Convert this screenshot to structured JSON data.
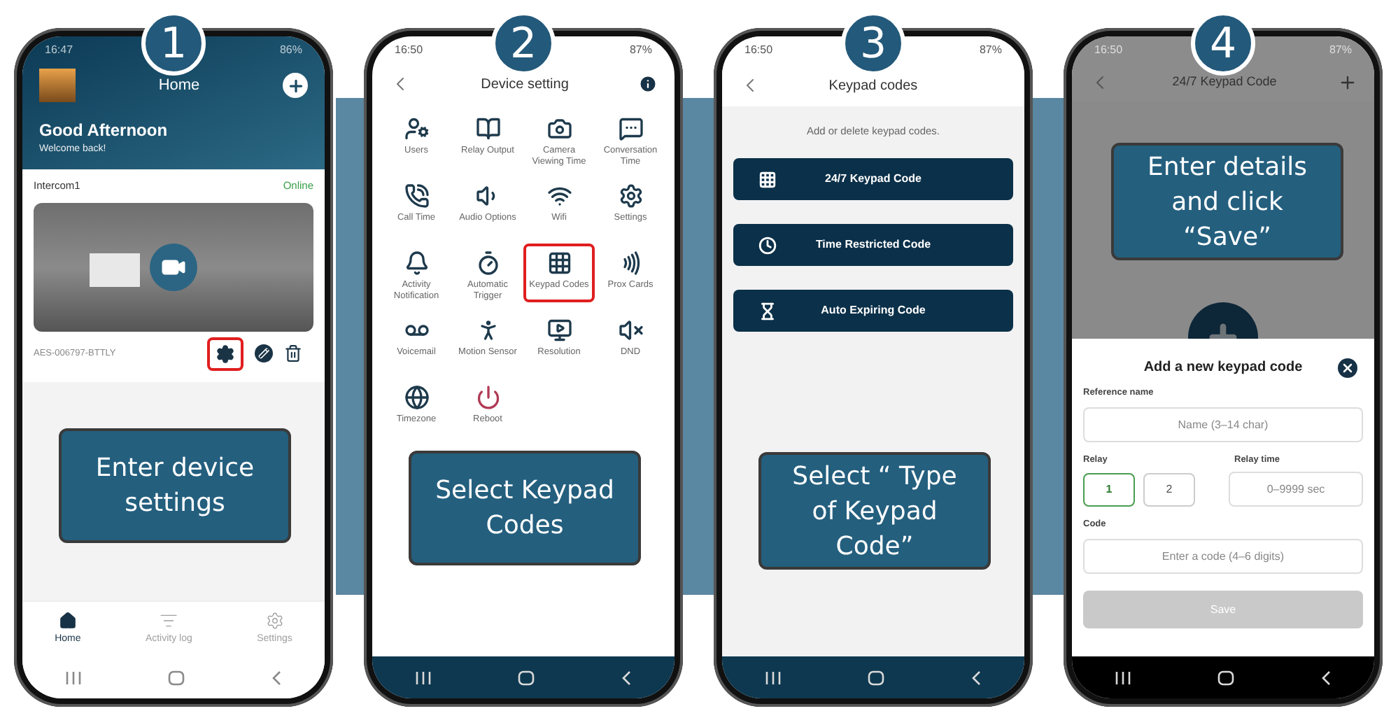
{
  "phones": [
    {
      "kind": "home",
      "step": "1",
      "instruction": "Enter device settings",
      "status": {
        "time": "16:47",
        "battery": "86%"
      },
      "title": "Home",
      "greeting": "Good Afternoon",
      "subtitle": "Welcome back!",
      "device": {
        "name": "Intercom1",
        "state": "Online",
        "id": "AES-006797-BTTLY",
        "settings_highlighted": true
      },
      "nav": [
        {
          "label": "Home",
          "selected": true
        },
        {
          "label": "Activity log",
          "selected": false
        },
        {
          "label": "Settings",
          "selected": false
        }
      ]
    },
    {
      "kind": "settings_grid",
      "step": "2",
      "instruction": "Select Keypad Codes",
      "status": {
        "time": "16:50",
        "battery": "87%"
      },
      "title": "Device setting",
      "items": [
        {
          "label": "Users",
          "highlighted": false,
          "color": "#1e3a4c"
        },
        {
          "label": "Relay Output",
          "highlighted": false,
          "color": "#1e3a4c"
        },
        {
          "label": "Camera Viewing Time",
          "highlighted": false,
          "color": "#1e3a4c"
        },
        {
          "label": "Conversation Time",
          "highlighted": false,
          "color": "#1e3a4c"
        },
        {
          "label": "Call Time",
          "highlighted": false,
          "color": "#1e3a4c"
        },
        {
          "label": "Audio Options",
          "highlighted": false,
          "color": "#1e3a4c"
        },
        {
          "label": "Wifi",
          "highlighted": false,
          "color": "#1e3a4c"
        },
        {
          "label": "Settings",
          "highlighted": false,
          "color": "#1e3a4c"
        },
        {
          "label": "Activity Notification",
          "highlighted": false,
          "color": "#1e3a4c"
        },
        {
          "label": "Automatic Trigger",
          "highlighted": false,
          "color": "#1e3a4c"
        },
        {
          "label": "Keypad Codes",
          "highlighted": true,
          "color": "#1e3a4c"
        },
        {
          "label": "Prox Cards",
          "highlighted": false,
          "color": "#1e3a4c"
        },
        {
          "label": "Voicemail",
          "highlighted": false,
          "color": "#1e3a4c"
        },
        {
          "label": "Motion Sensor",
          "highlighted": false,
          "color": "#1e3a4c"
        },
        {
          "label": "Resolution",
          "highlighted": false,
          "color": "#1e3a4c"
        },
        {
          "label": "DND",
          "highlighted": false,
          "color": "#1e3a4c"
        },
        {
          "label": "Timezone",
          "highlighted": false,
          "color": "#1e3a4c"
        },
        {
          "label": "Reboot",
          "highlighted": false,
          "color": "#b03a55"
        }
      ]
    },
    {
      "kind": "code_types",
      "step": "3",
      "instruction": "Select “ Type of Keypad Code”",
      "status": {
        "time": "16:50",
        "battery": "87%"
      },
      "title": "Keypad codes",
      "hint": "Add or delete keypad codes.",
      "options": [
        "24/7 Keypad Code",
        "Time Restricted Code",
        "Auto Expiring Code"
      ]
    },
    {
      "kind": "code_form",
      "step": "4",
      "instruction": "Enter details and click “Save”",
      "status": {
        "time": "16:50",
        "battery": "87%"
      },
      "title": "24/7 Keypad Code",
      "dialog": {
        "title": "Add a new keypad code",
        "name_label": "Reference name",
        "name_placeholder": "Name (3–14 char)",
        "relay_label": "Relay",
        "relays": [
          {
            "label": "1",
            "selected": true
          },
          {
            "label": "2",
            "selected": false
          }
        ],
        "time_label": "Relay time",
        "time_placeholder": "0–9999 sec",
        "code_label": "Code",
        "code_placeholder": "Enter a code (4–6 digits)",
        "save": {
          "label": "Save",
          "disabled": true
        }
      }
    }
  ]
}
